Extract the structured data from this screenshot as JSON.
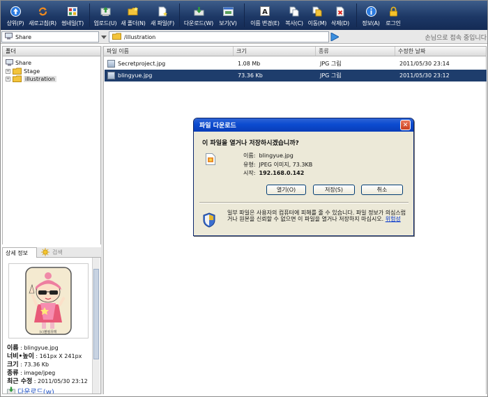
{
  "toolbar": {
    "buttons": [
      {
        "label": "상위(P)",
        "icon": "up-arrow-icon"
      },
      {
        "label": "새로고침(R)",
        "icon": "refresh-icon"
      },
      {
        "label": "썸네일(T)",
        "icon": "thumbnail-icon"
      },
      {
        "label": "업로드(U)",
        "icon": "upload-icon"
      },
      {
        "label": "새 폴더(N)",
        "icon": "new-folder-icon"
      },
      {
        "label": "새 파일(F)",
        "icon": "new-file-icon"
      },
      {
        "label": "다운로드(W)",
        "icon": "download-icon"
      },
      {
        "label": "보기(V)",
        "icon": "view-icon"
      },
      {
        "label": "이름 변경(E)",
        "icon": "rename-icon"
      },
      {
        "label": "복사(C)",
        "icon": "copy-icon"
      },
      {
        "label": "이동(M)",
        "icon": "move-icon"
      },
      {
        "label": "삭제(D)",
        "icon": "delete-icon"
      },
      {
        "label": "정보(A)",
        "icon": "info-icon"
      },
      {
        "label": "로그인",
        "icon": "lock-icon"
      }
    ]
  },
  "addressbar": {
    "share_label": "Share",
    "path": "/illustration",
    "guest_status": "손님으로 접속 중입니다"
  },
  "folders": {
    "header": "폴더",
    "root": "Share",
    "children": [
      {
        "name": "Stage",
        "selected": false
      },
      {
        "name": "illustration",
        "selected": true
      }
    ]
  },
  "files": {
    "columns": [
      "파일 이름",
      "크기",
      "종류",
      "수정한 날짜"
    ],
    "rows": [
      {
        "name": "Secretproject.jpg",
        "size": "1.08 Mb",
        "type": "JPG 그림",
        "modified": "2011/05/30 23:14",
        "selected": false
      },
      {
        "name": "blingyue.jpg",
        "size": "73.36 Kb",
        "type": "JPG 그림",
        "modified": "2011/05/30 23:12",
        "selected": true
      }
    ]
  },
  "details": {
    "tab_details": "상세 정보",
    "tab_search": "검색",
    "preview_caption": "(c)블링유에",
    "fields": [
      {
        "key": "이름",
        "value": "blingyue.jpg"
      },
      {
        "key": "너비•높이",
        "value": "161px X 241px"
      },
      {
        "key": "크기",
        "value": "73.36 Kb"
      },
      {
        "key": "종류",
        "value": "image/jpeg"
      },
      {
        "key": "최근 수정",
        "value": "2011/05/30 23:12"
      }
    ],
    "download_label": "다운로드(w)"
  },
  "dialog": {
    "title": "파일 다운로드",
    "question": "이 파일을 열거나 저장하시겠습니까?",
    "name_label": "이름:",
    "name_value": "blingyue.jpg",
    "type_label": "유형:",
    "type_value": "JPEG 이미지, 73.3KB",
    "from_label": "시작:",
    "from_value": "192.168.0.142",
    "open_button": "열기(O)",
    "save_button": "저장(S)",
    "cancel_button": "취소",
    "warning": "일부 파일은 사용자의 컴퓨터에 피해를 줄 수 있습니다. 파일 정보가 의심스럽거나 원본을 신뢰할 수 없으면 이 파일을 열거나 저장하지 마십시오.",
    "warning_link": "위험성"
  },
  "colors": {
    "toolbar": "#1d3866",
    "selection": "#1e3d6c",
    "dialog_title": "#0b4bd0",
    "dialog_body": "#ece9d8"
  }
}
